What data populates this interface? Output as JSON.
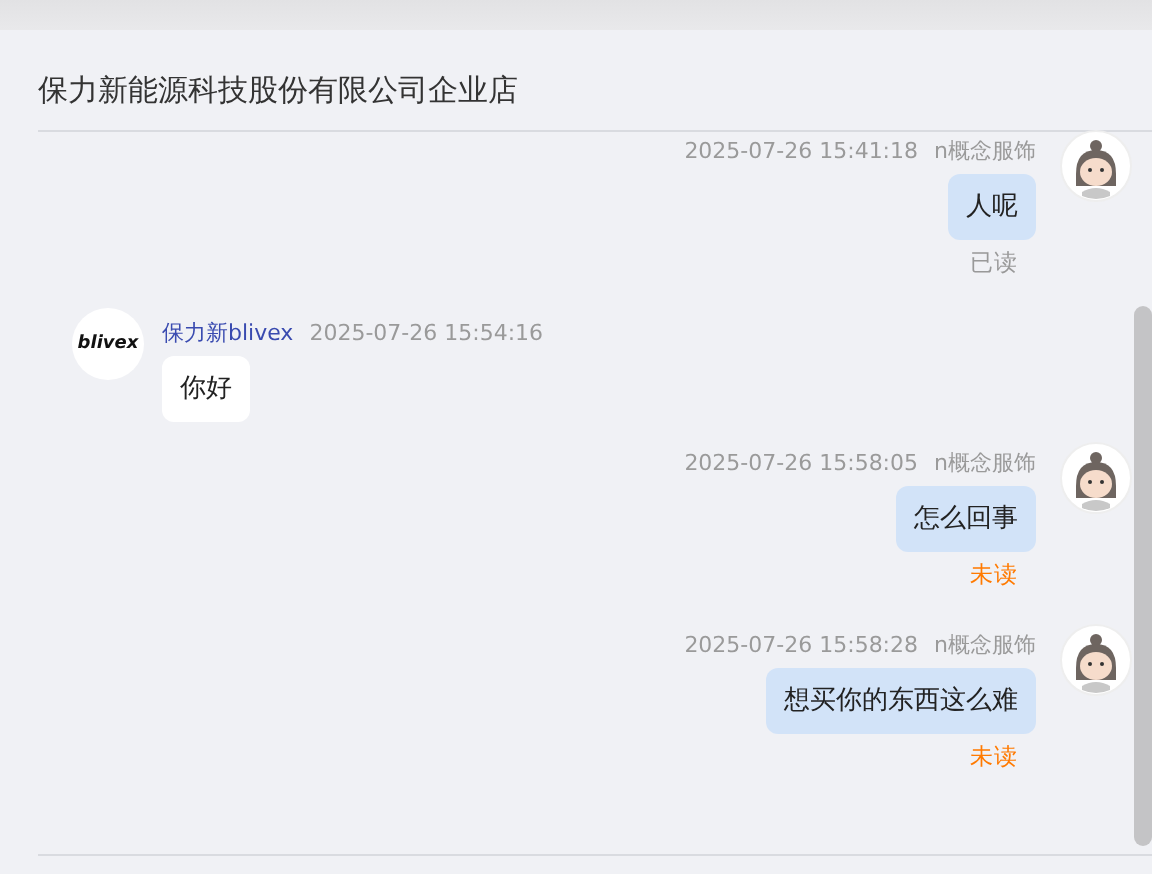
{
  "header": {
    "title": "保力新能源科技股份有限公司企业店"
  },
  "messages": [
    {
      "kind": "outgoing",
      "time": "2025-07-26 15:41:18",
      "sender": "n概念服饰",
      "text": "人呢",
      "status": "已读",
      "read": true
    },
    {
      "kind": "incoming",
      "time": "2025-07-26 15:54:16",
      "sender": "保力新blivex",
      "text": "你好",
      "logo_text": "blivex"
    },
    {
      "kind": "outgoing",
      "time": "2025-07-26 15:58:05",
      "sender": "n概念服饰",
      "text": "怎么回事",
      "status": "未读",
      "read": false
    },
    {
      "kind": "outgoing",
      "time": "2025-07-26 15:58:28",
      "sender": "n概念服饰",
      "text": "想买你的东西这么难",
      "status": "未读",
      "read": false
    }
  ]
}
